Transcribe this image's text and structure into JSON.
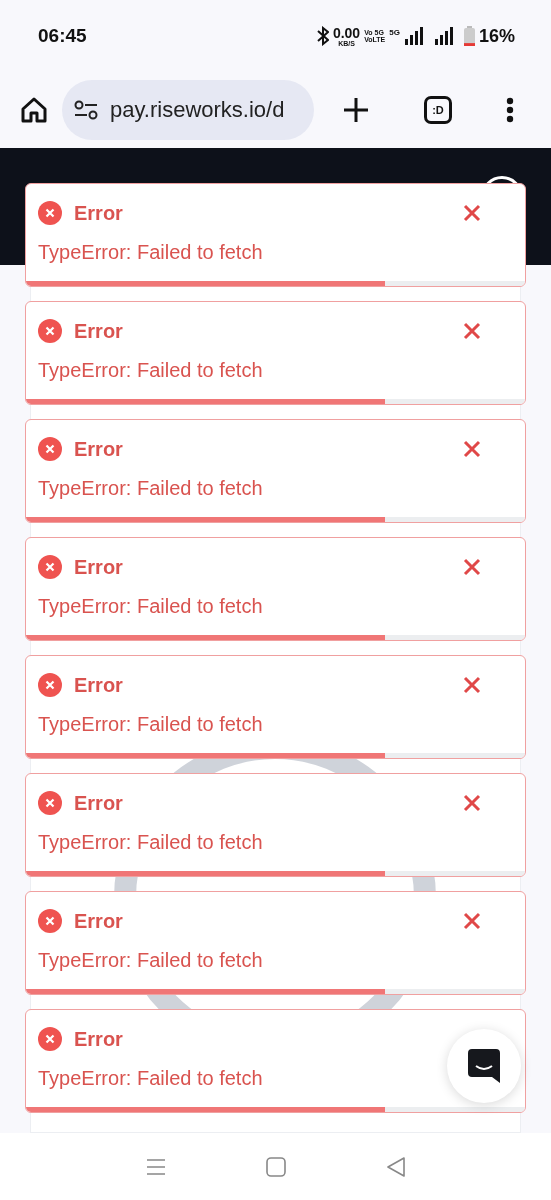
{
  "status_bar": {
    "time": "06:45",
    "speed": "0.00",
    "speed_unit": "KB/S",
    "volte_top": "Vo 5G",
    "volte_bottom": "VoLTE",
    "network": "5G",
    "battery": "16%"
  },
  "browser": {
    "url": "pay.riseworks.io/d",
    "tab_count": ":D"
  },
  "toasts": [
    {
      "title": "Error",
      "message": "TypeError: Failed to fetch",
      "level": 0.72,
      "close_visible": true
    },
    {
      "title": "Error",
      "message": "TypeError: Failed to fetch",
      "level": 0.72,
      "close_visible": true
    },
    {
      "title": "Error",
      "message": "TypeError: Failed to fetch",
      "level": 0.72,
      "close_visible": true
    },
    {
      "title": "Error",
      "message": "TypeError: Failed to fetch",
      "level": 0.72,
      "close_visible": true
    },
    {
      "title": "Error",
      "message": "TypeError: Failed to fetch",
      "level": 0.72,
      "close_visible": true
    },
    {
      "title": "Error",
      "message": "TypeError: Failed to fetch",
      "level": 0.72,
      "close_visible": true
    },
    {
      "title": "Error",
      "message": "TypeError: Failed to fetch",
      "level": 0.72,
      "close_visible": true
    },
    {
      "title": "Error",
      "message": "TypeError: Failed to fetch",
      "level": 0.72,
      "close_visible": false
    }
  ]
}
